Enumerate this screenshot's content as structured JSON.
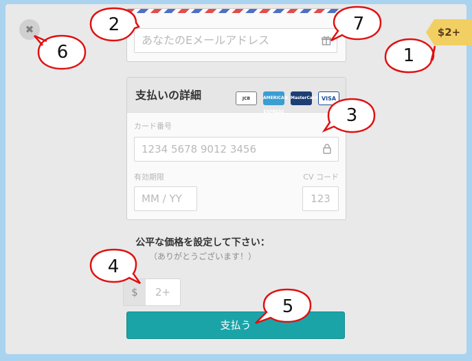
{
  "close_label": "✖",
  "price_tag": "$2+",
  "email": {
    "placeholder": "あなたのEメールアドレス"
  },
  "payment": {
    "title": "支払いの詳細",
    "card_logos": [
      "JCB",
      "AMERICAN EXPRESS",
      "MasterCard",
      "VISA"
    ],
    "card_number_label": "カード番号",
    "card_number_placeholder": "1234 5678 9012 3456",
    "expiry_label": "有効期限",
    "expiry_placeholder": "MM / YY",
    "cvc_label": "CV コード",
    "cvc_placeholder": "123"
  },
  "fair_price": {
    "title": "公平な価格を設定して下さい：",
    "subtitle": "（ありがとうございます！）",
    "currency": "$",
    "value_placeholder": "2+"
  },
  "pay_button": "支払う",
  "annotations": [
    "1",
    "2",
    "3",
    "4",
    "5",
    "6",
    "7"
  ],
  "colors": {
    "background": "#a9d3ee",
    "dialog": "#e9e9e9",
    "price_tag": "#f2cf62",
    "pay_button": "#1aa4a8",
    "callout_stroke": "#e01010"
  }
}
